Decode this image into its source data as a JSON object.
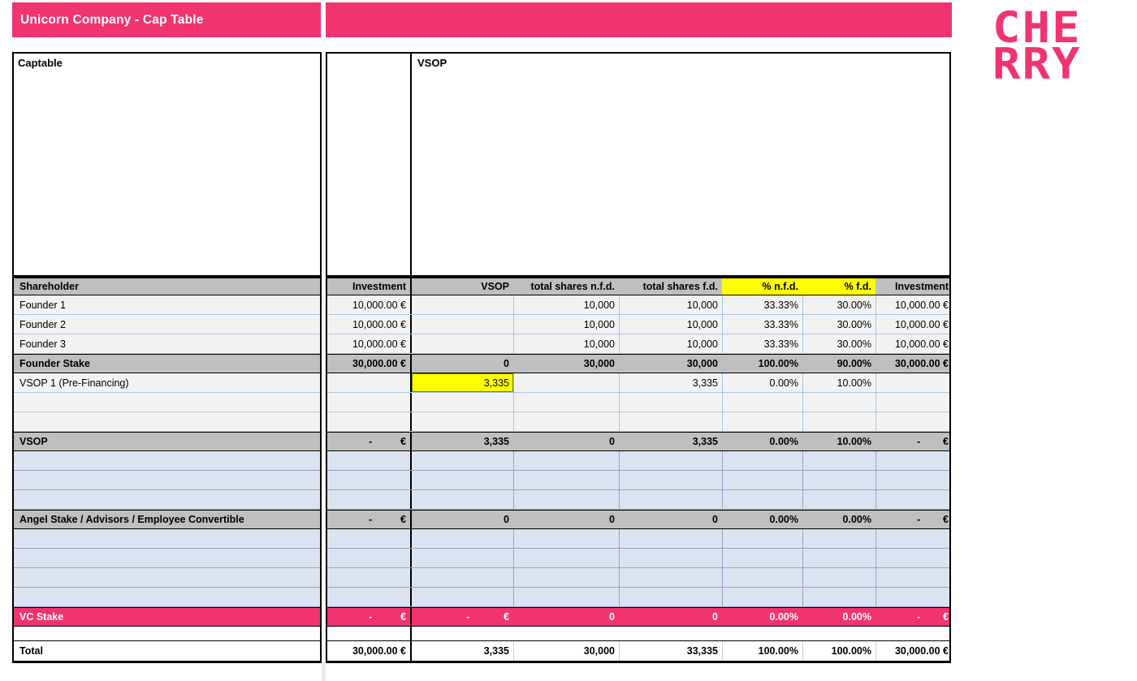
{
  "title_bar": {
    "title": "Unicorn Company - Cap Table"
  },
  "logo": {
    "line1": "CHE",
    "line2": "RRY"
  },
  "panels": {
    "captable_label": "Captable",
    "vsop_label": "VSOP"
  },
  "columns": [
    "Shareholder",
    "Investment",
    "VSOP",
    "total shares n.f.d.",
    "total shares f.d.",
    "% n.f.d.",
    "% f.d.",
    "Investment"
  ],
  "yellow_columns": [
    5,
    6
  ],
  "rows": [
    {
      "name": "founder-1",
      "type": "data",
      "cells": [
        "Founder 1",
        "10,000.00 €",
        "",
        "10,000",
        "10,000",
        "33.33%",
        "30.00%",
        "10,000.00 €"
      ]
    },
    {
      "name": "founder-2",
      "type": "data",
      "cells": [
        "Founder 2",
        "10,000.00 €",
        "",
        "10,000",
        "10,000",
        "33.33%",
        "30.00%",
        "10,000.00 €"
      ]
    },
    {
      "name": "founder-3",
      "type": "data",
      "cells": [
        "Founder 3",
        "10,000.00 €",
        "",
        "10,000",
        "10,000",
        "33.33%",
        "30.00%",
        "10,000.00 €"
      ]
    },
    {
      "name": "founder-stake-subtotal",
      "type": "subtotal",
      "cells": [
        "Founder Stake",
        "30,000.00 €",
        "0",
        "30,000",
        "30,000",
        "100.00%",
        "90.00%",
        "30,000.00 €"
      ]
    },
    {
      "name": "vsop-1-pre-financing",
      "type": "data",
      "highlight_cell": 2,
      "cells": [
        "VSOP 1 (Pre-Financing)",
        "",
        "3,335",
        "",
        "3,335",
        "0.00%",
        "10.00%",
        ""
      ]
    },
    {
      "name": "empty-row",
      "type": "data",
      "cells": [
        "",
        "",
        "",
        "",
        "",
        "",
        "",
        ""
      ]
    },
    {
      "name": "empty-row",
      "type": "data",
      "cells": [
        "",
        "",
        "",
        "",
        "",
        "",
        "",
        ""
      ]
    },
    {
      "name": "vsop-subtotal",
      "type": "subtotal",
      "cells": [
        "VSOP",
        "-          €",
        "3,335",
        "0",
        "3,335",
        "0.00%",
        "10.00%",
        "-        €"
      ]
    },
    {
      "name": "empty-row",
      "type": "blue",
      "cells": [
        "",
        "",
        "",
        "",
        "",
        "",
        "",
        ""
      ]
    },
    {
      "name": "empty-row",
      "type": "blue",
      "cells": [
        "",
        "",
        "",
        "",
        "",
        "",
        "",
        ""
      ]
    },
    {
      "name": "empty-row",
      "type": "blue",
      "cells": [
        "",
        "",
        "",
        "",
        "",
        "",
        "",
        ""
      ]
    },
    {
      "name": "angel-stake-subtotal",
      "type": "subtotal",
      "cells": [
        "Angel Stake / Advisors / Employee Convertible",
        "-          €",
        "0",
        "0",
        "0",
        "0.00%",
        "0.00%",
        "-        €"
      ]
    },
    {
      "name": "empty-row",
      "type": "blue",
      "cells": [
        "",
        "",
        "",
        "",
        "",
        "",
        "",
        ""
      ]
    },
    {
      "name": "empty-row",
      "type": "blue",
      "cells": [
        "",
        "",
        "",
        "",
        "",
        "",
        "",
        ""
      ]
    },
    {
      "name": "empty-row",
      "type": "blue",
      "cells": [
        "",
        "",
        "",
        "",
        "",
        "",
        "",
        ""
      ]
    },
    {
      "name": "empty-row",
      "type": "blue",
      "cells": [
        "",
        "",
        "",
        "",
        "",
        "",
        "",
        ""
      ]
    },
    {
      "name": "vc-stake-subtotal",
      "type": "vc",
      "cells": [
        "VC Stake",
        "-          €",
        "-            €",
        "0",
        "0",
        "0.00%",
        "0.00%",
        "-        €"
      ]
    },
    {
      "name": "spacer-row",
      "type": "spacer",
      "cells": [
        "",
        "",
        "",
        "",
        "",
        "",
        "",
        ""
      ]
    },
    {
      "name": "total",
      "type": "total",
      "cells": [
        "Total",
        "30,000.00 €",
        "3,335",
        "30,000",
        "33,335",
        "100.00%",
        "100.00%",
        "30,000.00 €"
      ]
    }
  ],
  "colors": {
    "brand_pink": "#F1336F",
    "header_gray": "#BFBFBF",
    "row_gray": "#F2F2F2",
    "row_blue": "#DCE3F0",
    "highlight_yellow": "#FFFF00"
  }
}
